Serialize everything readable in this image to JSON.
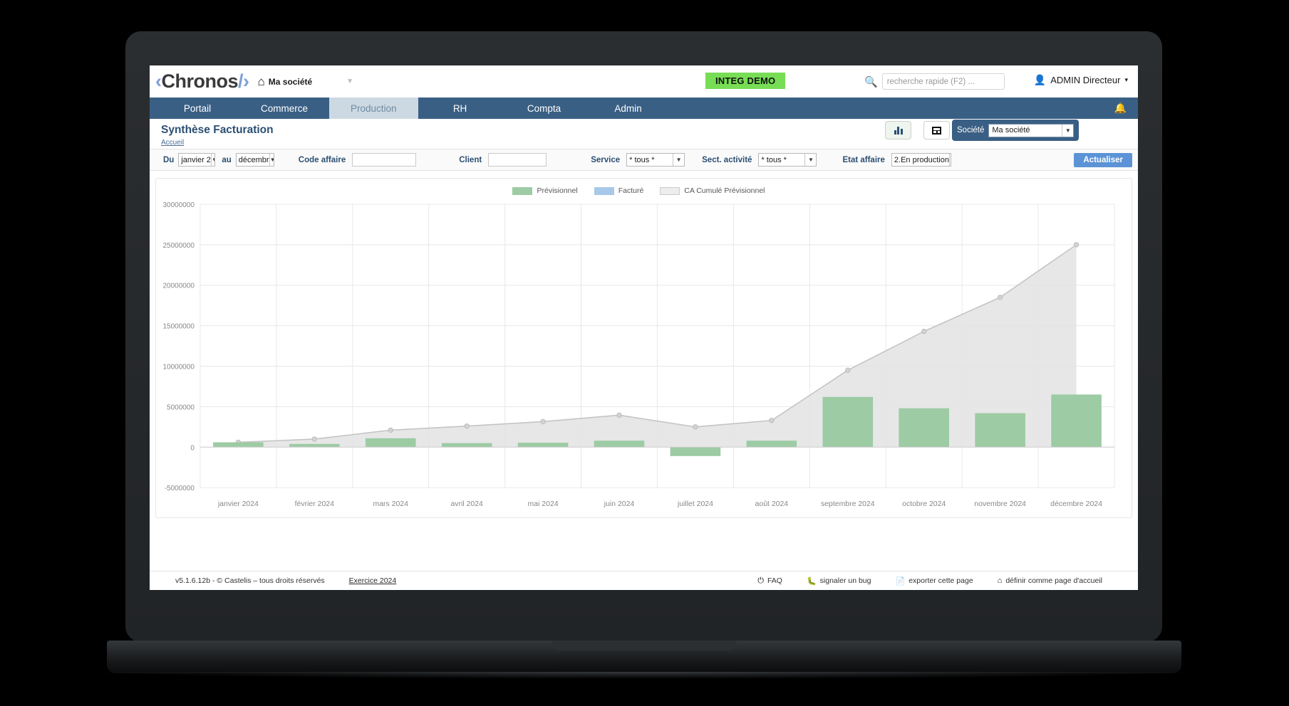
{
  "app": {
    "logo_left": "‹",
    "logo_text": "Chronos",
    "logo_slash": "/",
    "logo_right": "›",
    "home_icon": "home-icon",
    "company": "Ma société",
    "badge": "INTEG DEMO"
  },
  "search": {
    "icon": "search-icon",
    "placeholder": "recherche rapide (F2) ...",
    "value": ""
  },
  "user": {
    "icon": "user-icon",
    "name": "ADMIN Directeur",
    "caret": "▾"
  },
  "nav": {
    "items": [
      {
        "label": "Portail",
        "active": false
      },
      {
        "label": "Commerce",
        "active": false
      },
      {
        "label": "Production",
        "active": true
      },
      {
        "label": "RH",
        "active": false
      },
      {
        "label": "Compta",
        "active": false
      },
      {
        "label": "Admin",
        "active": false
      }
    ],
    "bell_icon": "bell-icon"
  },
  "page": {
    "title": "Synthèse Facturation",
    "breadcrumb": "Accueil",
    "view_chart_icon": "bar-chart-icon",
    "view_table_icon": "table-icon",
    "societe_label": "Société",
    "societe_value": "Ma société"
  },
  "filters": {
    "du_label": "Du",
    "du_value": "janvier 2",
    "au_label": "au",
    "au_value": "décembr",
    "code_affaire_label": "Code affaire",
    "code_affaire_value": "",
    "client_label": "Client",
    "client_value": "",
    "service_label": "Service",
    "service_value": "* tous *",
    "secteur_label": "Sect. activité",
    "secteur_value": "* tous *",
    "etat_label": "Etat affaire",
    "etat_value": "2.En production",
    "refresh_label": "Actualiser"
  },
  "footer": {
    "copyright": "v5.1.6.12b - © Castelis – tous droits réservés",
    "exercice": "Exercice 2024",
    "links": [
      {
        "icon": "question-circle-icon",
        "label": "FAQ"
      },
      {
        "icon": "bug-icon",
        "label": "signaler un bug"
      },
      {
        "icon": "export-icon",
        "label": "exporter cette page"
      },
      {
        "icon": "home-icon",
        "label": "définir comme page d'accueil"
      }
    ]
  },
  "chart_data": {
    "type": "bar",
    "title": "",
    "xlabel": "",
    "ylabel": "",
    "ylim": [
      -5000000,
      30000000
    ],
    "yticks": [
      30000000,
      25000000,
      20000000,
      15000000,
      10000000,
      5000000,
      0,
      -5000000
    ],
    "ytick_labels": [
      "30000000",
      "25000000",
      "20000000",
      "15000000",
      "10000000",
      "5000000",
      "0",
      "-5000000"
    ],
    "grid": true,
    "legend_position": "top-center",
    "categories": [
      "janvier 2024",
      "février 2024",
      "mars 2024",
      "avril 2024",
      "mai 2024",
      "juin 2024",
      "juillet 2024",
      "août 2024",
      "septembre 2024",
      "octobre 2024",
      "novembre 2024",
      "décembre 2024"
    ],
    "series": [
      {
        "name": "Prévisionnel",
        "type": "bar",
        "color": "#9ccba4",
        "values": [
          600000,
          400000,
          1100000,
          500000,
          550000,
          800000,
          -1100000,
          800000,
          6200000,
          4800000,
          4200000,
          6500000
        ]
      },
      {
        "name": "Facturé",
        "type": "bar",
        "color": "#a8c8e8",
        "values": [
          0,
          0,
          0,
          0,
          0,
          0,
          0,
          0,
          0,
          0,
          0,
          0
        ]
      },
      {
        "name": "CA Cumulé Prévisionnel",
        "type": "area",
        "color": "#e3e3e3",
        "values": [
          600000,
          1000000,
          2100000,
          2600000,
          3150000,
          3950000,
          2500000,
          3300000,
          9500000,
          14300000,
          18500000,
          25000000
        ]
      }
    ]
  }
}
